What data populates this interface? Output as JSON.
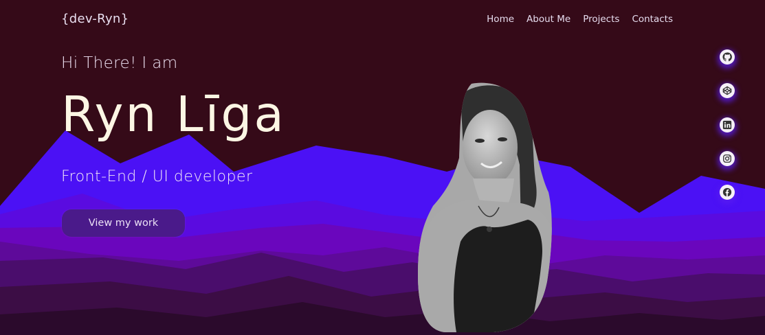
{
  "brand": {
    "logo": "{dev-Ryn}"
  },
  "nav": [
    {
      "label": "Home"
    },
    {
      "label": "About Me"
    },
    {
      "label": "Projects"
    },
    {
      "label": "Contacts"
    }
  ],
  "hero": {
    "greeting": "Hi There! I am",
    "name": "Ryn Līga",
    "role": "Front-End / UI developer",
    "cta": "View my work"
  },
  "socials": [
    {
      "icon": "github-icon"
    },
    {
      "icon": "codepen-icon"
    },
    {
      "icon": "linkedin-icon"
    },
    {
      "icon": "instagram-icon"
    },
    {
      "icon": "facebook-icon"
    }
  ],
  "colors": {
    "background": "#350a18",
    "mountain_front": "#4b11f5",
    "mountain_mid": "#6a06bd",
    "mountain_dark": "#3c0d45",
    "button": "#4a1a8a",
    "name_text": "#fcf6e4"
  }
}
